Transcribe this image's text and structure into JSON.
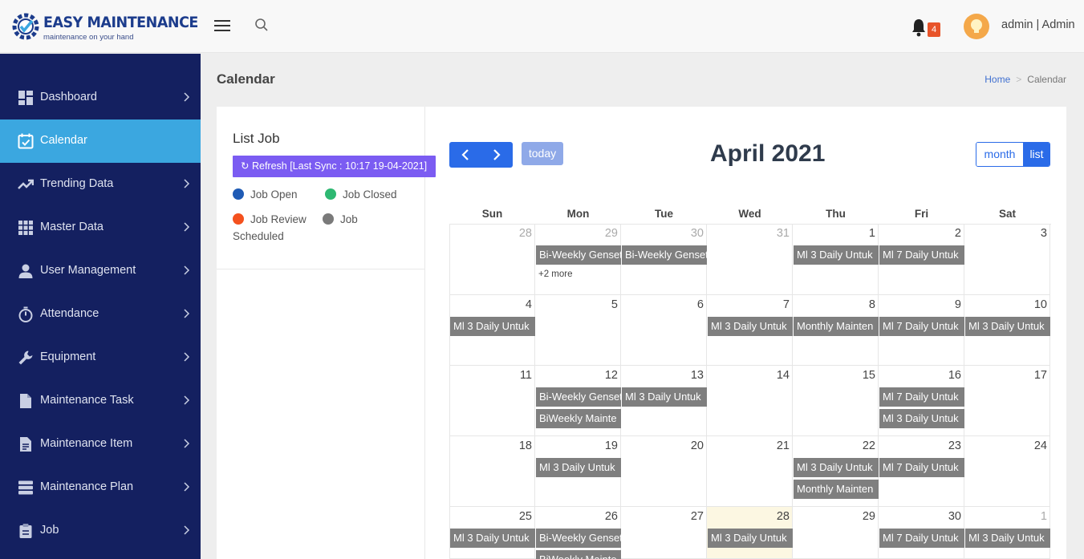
{
  "brand": {
    "name": "EASY MAINTENANCE",
    "tagline": "maintenance on your hand"
  },
  "header": {
    "notification_count": "4",
    "user": "admin | Admin"
  },
  "sidebar": {
    "items": [
      {
        "label": "Dashboard",
        "icon": "dashboard-icon"
      },
      {
        "label": "Calendar",
        "icon": "calendar-icon"
      },
      {
        "label": "Trending Data",
        "icon": "trending-icon"
      },
      {
        "label": "Master Data",
        "icon": "grid-icon"
      },
      {
        "label": "User Management",
        "icon": "user-icon"
      },
      {
        "label": "Attendance",
        "icon": "stopwatch-icon"
      },
      {
        "label": "Equipment",
        "icon": "wrench-icon"
      },
      {
        "label": "Maintenance Task",
        "icon": "file-icon"
      },
      {
        "label": "Maintenance Item",
        "icon": "document-icon"
      },
      {
        "label": "Maintenance Plan",
        "icon": "server-icon"
      },
      {
        "label": "Job",
        "icon": "clipboard-icon"
      }
    ]
  },
  "page": {
    "title": "Calendar",
    "breadcrumb_home": "Home",
    "breadcrumb_current": "Calendar"
  },
  "list_job": {
    "title": "List Job",
    "refresh_label": "Refresh [Last Sync : 10:17 19-04-2021]",
    "legend": [
      {
        "label": "Job Open",
        "color": "#1f5bb5"
      },
      {
        "label": "Job Closed",
        "color": "#2eb872"
      },
      {
        "label": "Job Review",
        "color": "#f4511e"
      },
      {
        "label": "Job",
        "color": "#7a7a7a"
      },
      {
        "label": "Scheduled"
      }
    ]
  },
  "calendar": {
    "title": "April 2021",
    "today_label": "today",
    "view_month": "month",
    "view_list": "list",
    "days_of_week": [
      "Sun",
      "Mon",
      "Tue",
      "Wed",
      "Thu",
      "Fri",
      "Sat"
    ],
    "more_label": "+2 more",
    "weeks": [
      [
        "28",
        "29",
        "30",
        "31",
        "1",
        "2",
        "3"
      ],
      [
        "4",
        "5",
        "6",
        "7",
        "8",
        "9",
        "10"
      ],
      [
        "11",
        "12",
        "13",
        "14",
        "15",
        "16",
        "17"
      ],
      [
        "18",
        "19",
        "20",
        "21",
        "22",
        "23",
        "24"
      ],
      [
        "25",
        "26",
        "27",
        "28",
        "29",
        "30",
        "1"
      ]
    ],
    "event_titles": {
      "biweekly_genset": "Bi-Weekly Genset",
      "ml3_daily": "Ml 3 Daily Untuk",
      "ml7_daily": "Ml 7 Daily Untuk",
      "monthly_maint": "Monthly Mainten",
      "biweekly_maint": "BiWeekly Mainte"
    }
  },
  "colors": {
    "sidebar": "#142060",
    "active": "#3ba7e0",
    "primary": "#2a6be8",
    "event": "#7f7f7f",
    "today_bg": "#fcf7e2"
  }
}
